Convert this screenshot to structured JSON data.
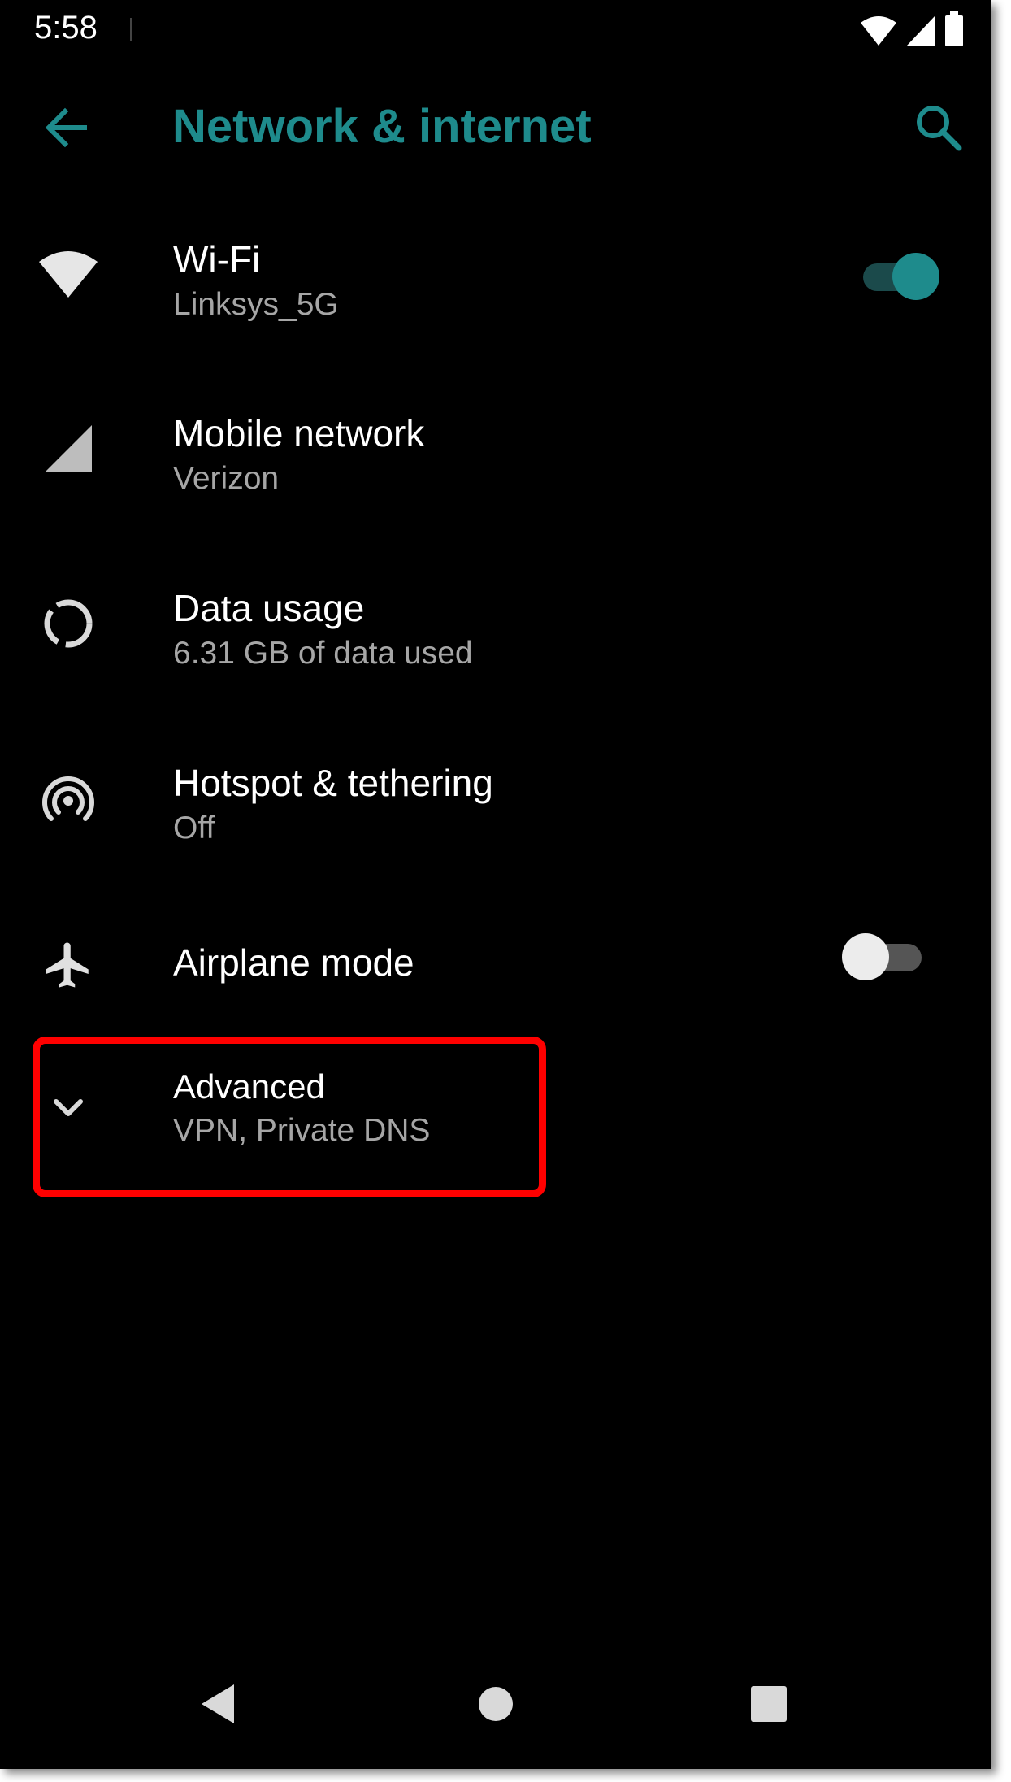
{
  "status_bar": {
    "time": "5:58",
    "icons": [
      "wifi-icon",
      "signal-icon",
      "battery-icon"
    ]
  },
  "toolbar": {
    "title": "Network & internet",
    "back_icon": "arrow-back-icon",
    "search_icon": "search-icon"
  },
  "colors": {
    "accent": "#1e8b8c",
    "background": "#000000",
    "primary_text": "#ffffff",
    "secondary_text": "#a6a6a6",
    "highlight": "#ff0000"
  },
  "items": [
    {
      "title": "Wi-Fi",
      "subtitle": "Linksys_5G",
      "icon": "wifi-icon",
      "toggle": true,
      "toggle_on": true
    },
    {
      "title": "Mobile network",
      "subtitle": "Verizon",
      "icon": "cellular-signal-icon"
    },
    {
      "title": "Data usage",
      "subtitle": "6.31 GB of data used",
      "icon": "data-usage-icon"
    },
    {
      "title": "Hotspot & tethering",
      "subtitle": "Off",
      "icon": "hotspot-icon"
    },
    {
      "title": "Airplane mode",
      "icon": "airplane-icon",
      "toggle": true,
      "toggle_on": false
    },
    {
      "title": "Advanced",
      "subtitle": "VPN, Private DNS",
      "icon": "chevron-down-icon",
      "highlighted": true
    }
  ],
  "nav_bar": {
    "buttons": [
      "back-triangle-icon",
      "home-circle-icon",
      "recents-square-icon"
    ]
  }
}
